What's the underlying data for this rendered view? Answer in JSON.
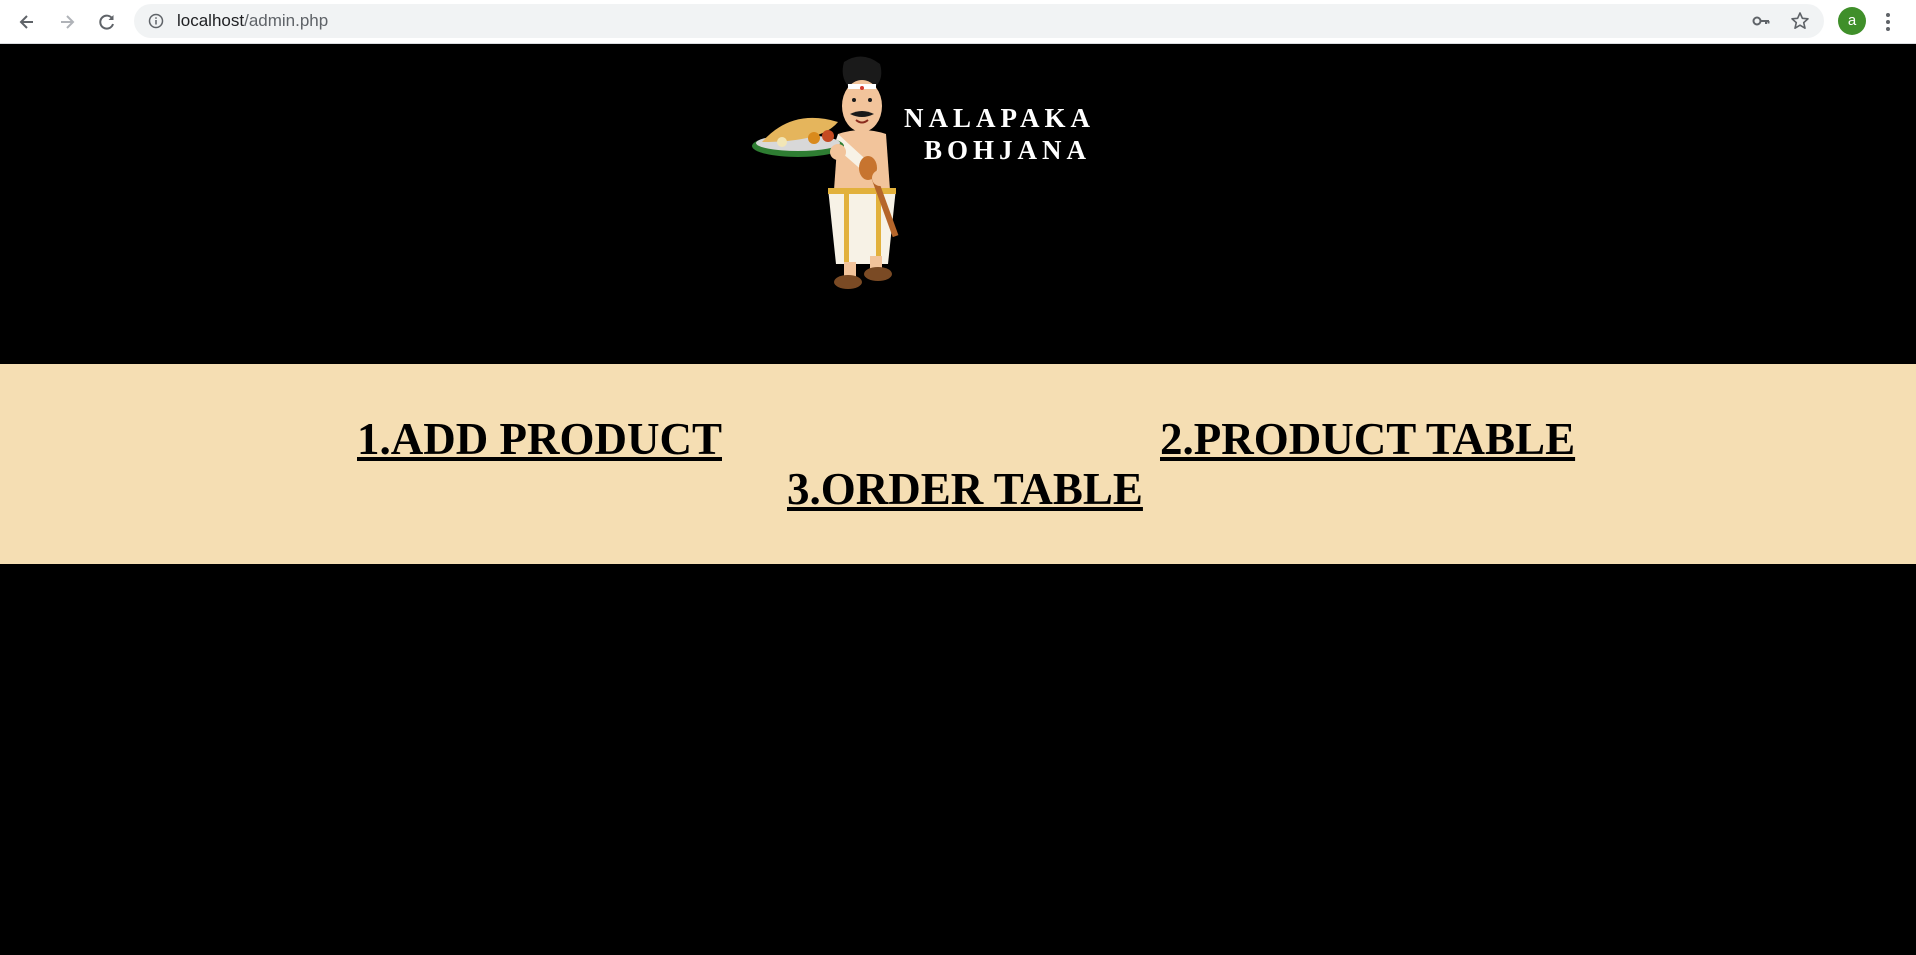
{
  "browser": {
    "url_host": "localhost",
    "url_path": "/admin.php",
    "profile_initial": "a",
    "icons": [
      "back-arrow-icon",
      "forward-arrow-icon",
      "reload-icon",
      "info-icon",
      "key-icon",
      "star-icon",
      "kebab-menu-icon"
    ]
  },
  "logo": {
    "line1": "NALAPAKA",
    "line2": "BOHJANA"
  },
  "menu": {
    "items": [
      {
        "label": "1.ADD PRODUCT"
      },
      {
        "label": "2.PRODUCT TABLE"
      },
      {
        "label": "3.ORDER TABLE"
      }
    ]
  },
  "colors": {
    "page_background": "#000000",
    "menu_background": "#f5deb3",
    "link_color": "#000000"
  }
}
